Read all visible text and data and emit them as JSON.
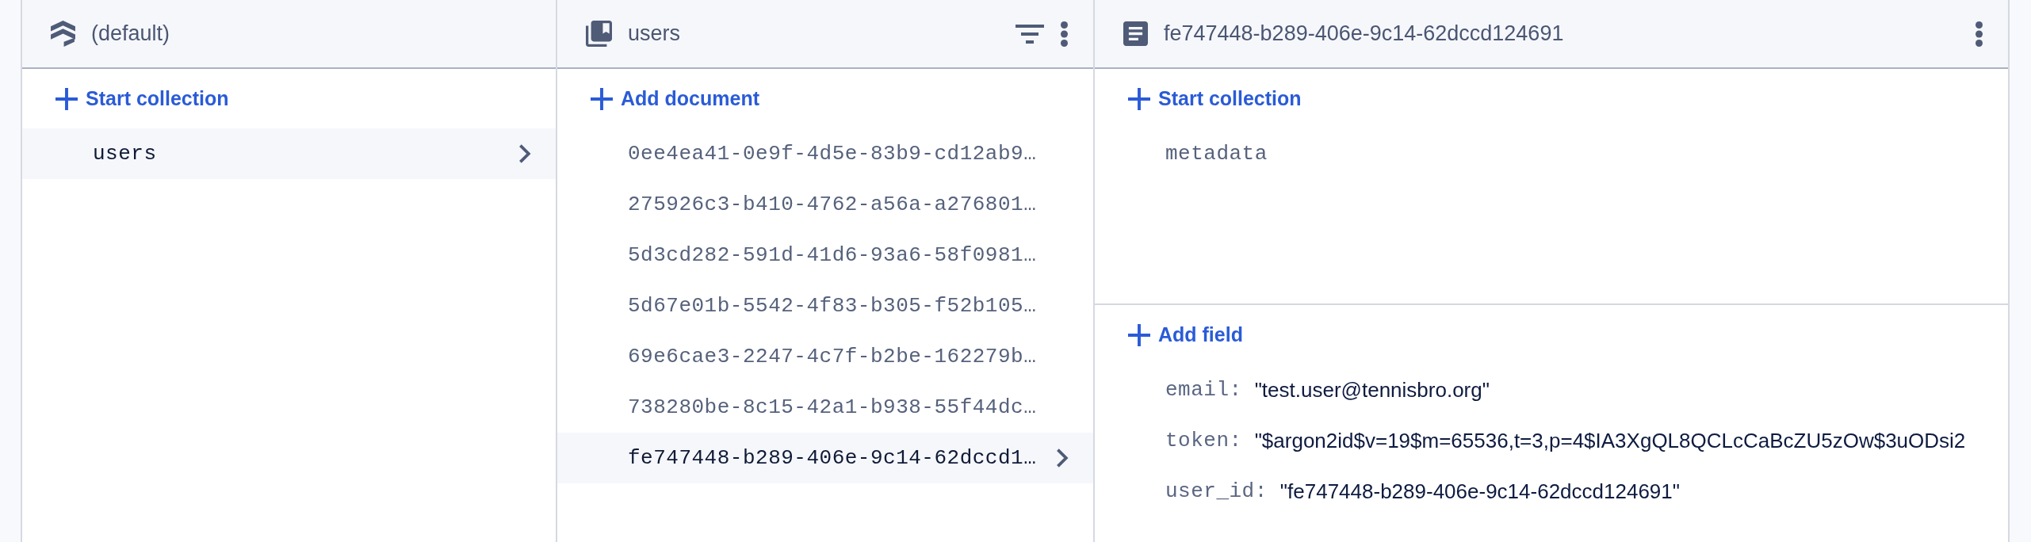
{
  "panels": [
    {
      "kind": "database",
      "title": "(default)",
      "action": {
        "label": "Start collection"
      },
      "items": [
        {
          "label": "users",
          "selected": true
        }
      ]
    },
    {
      "kind": "collection",
      "title": "users",
      "action": {
        "label": "Add document"
      },
      "items": [
        {
          "label": "0ee4ea41-0e9f-4d5e-83b9-cd12ab9…",
          "selected": false
        },
        {
          "label": "275926c3-b410-4762-a56a-a276801…",
          "selected": false
        },
        {
          "label": "5d3cd282-591d-41d6-93a6-58f0981…",
          "selected": false
        },
        {
          "label": "5d67e01b-5542-4f83-b305-f52b105…",
          "selected": false
        },
        {
          "label": "69e6cae3-2247-4c7f-b2be-162279b…",
          "selected": false
        },
        {
          "label": "738280be-8c15-42a1-b938-55f44dc…",
          "selected": false
        },
        {
          "label": "fe747448-b289-406e-9c14-62dccd1…",
          "selected": true
        }
      ]
    },
    {
      "kind": "document",
      "title": "fe747448-b289-406e-9c14-62dccd124691",
      "action": {
        "label": "Start collection"
      },
      "items": [
        {
          "label": "metadata",
          "selected": false
        }
      ],
      "field_action": {
        "label": "Add field"
      },
      "fields": [
        {
          "key": "email:",
          "value": "\"test.user@tennisbro.org\""
        },
        {
          "key": "token:",
          "value": "\"$argon2id$v=19$m=65536,t=3,p=4$IA3XgQL8QCLcCaBcZU5zOw$3uODsi2"
        },
        {
          "key": "user_id:",
          "value": "\"fe747448-b289-406e-9c14-62dccd124691\""
        }
      ]
    }
  ]
}
